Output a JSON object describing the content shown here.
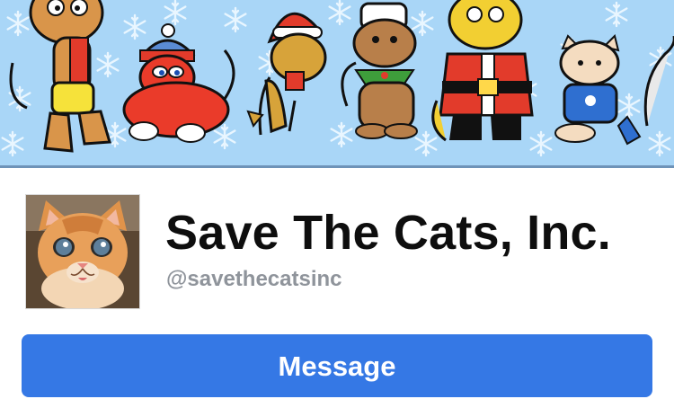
{
  "cover": {
    "description_icon": "holiday-cats-banner"
  },
  "profile": {
    "name": "Save The Cats, Inc.",
    "handle": "@savethecatsinc",
    "avatar_icon": "kitten-avatar"
  },
  "actions": {
    "message_label": "Message"
  },
  "colors": {
    "cover_background": "#a9d6f7",
    "button_background": "#3578e5",
    "handle_text": "#8f949b"
  }
}
